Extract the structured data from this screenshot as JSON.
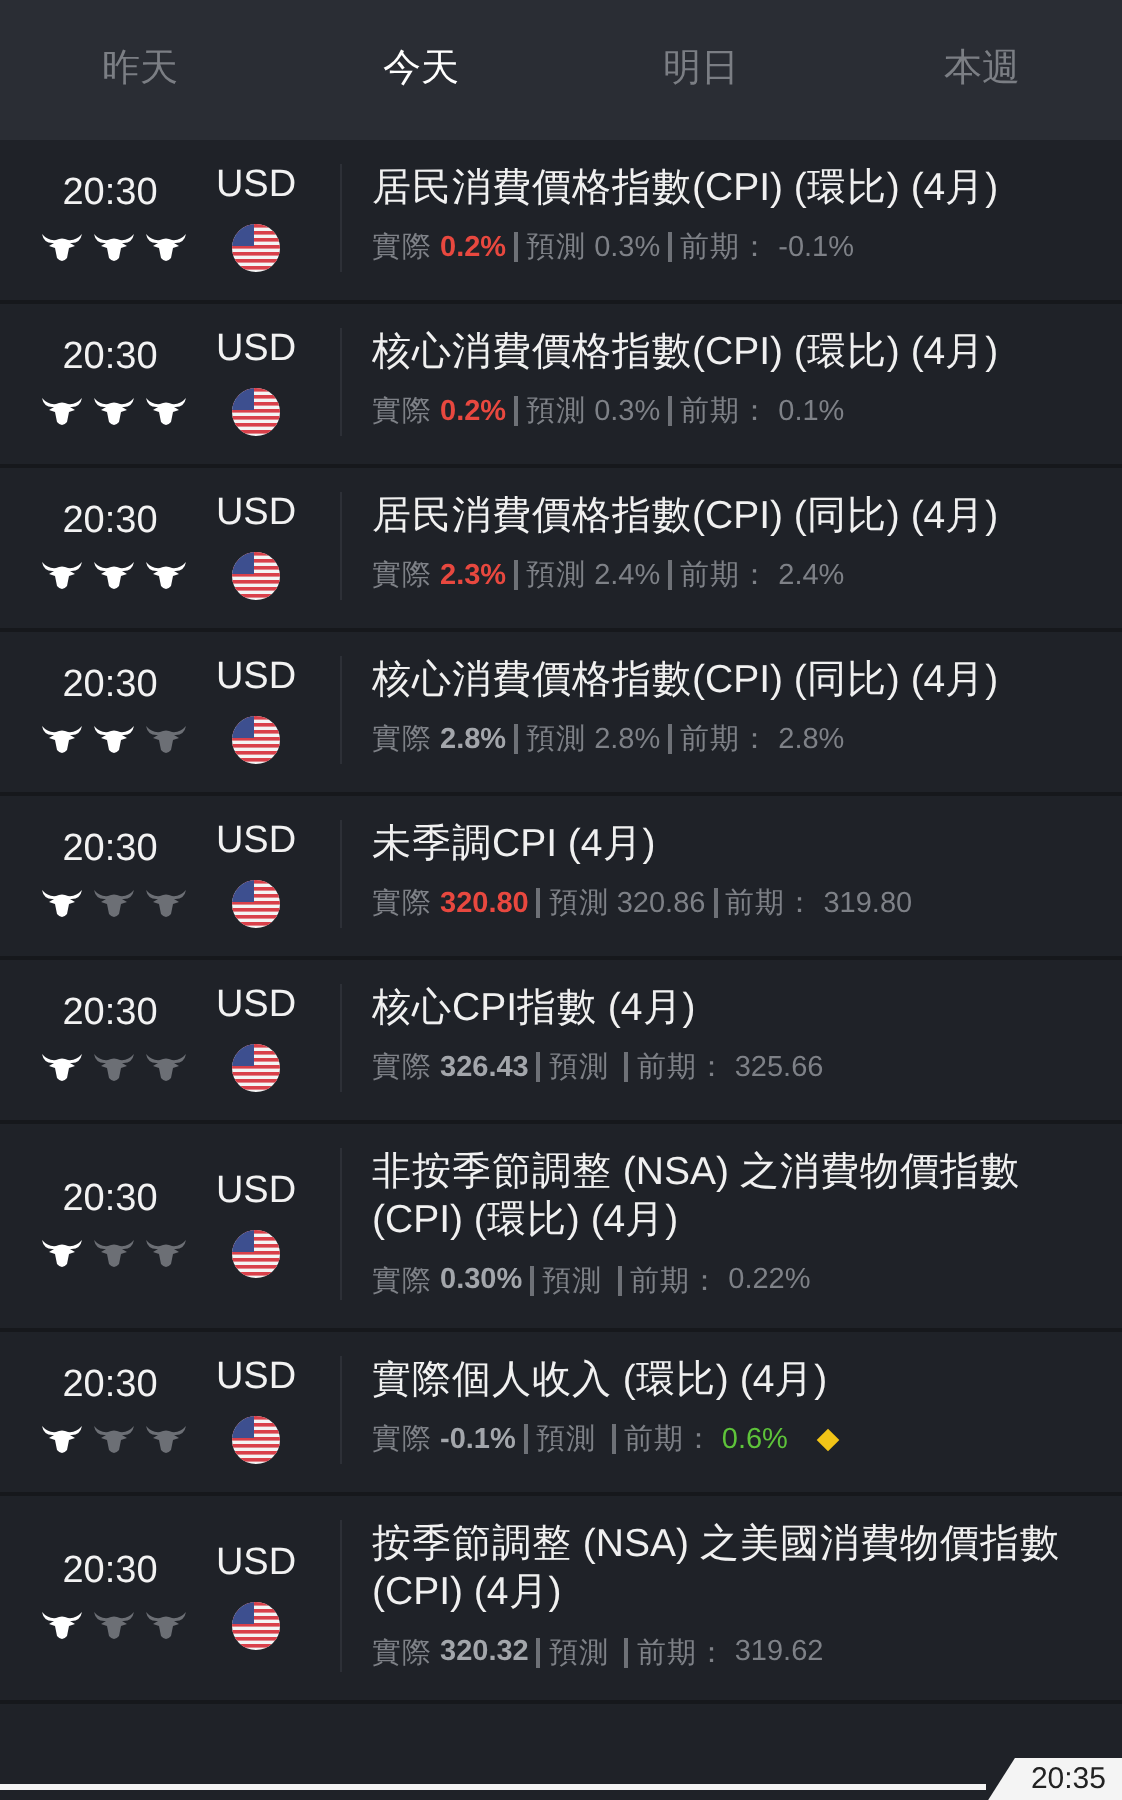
{
  "tabs": [
    {
      "label": "昨天",
      "selected": false
    },
    {
      "label": "今天",
      "selected": true
    },
    {
      "label": "明日",
      "selected": false
    },
    {
      "label": "本週",
      "selected": false
    }
  ],
  "events": [
    {
      "time": "20:30",
      "stars": 3,
      "currency": "USD",
      "title": "居民消費價格指數(CPI) (環比) (4月)",
      "actual_label": "實際",
      "actual": {
        "text": "0.2%",
        "color": "#e8483f"
      },
      "forecast_label": "預測",
      "forecast": "0.3%",
      "previous_label": "前期：",
      "previous": {
        "text": "-0.1%",
        "color": "#7e8187"
      },
      "revised": false
    },
    {
      "time": "20:30",
      "stars": 3,
      "currency": "USD",
      "title": "核心消費價格指數(CPI) (環比) (4月)",
      "actual_label": "實際",
      "actual": {
        "text": "0.2%",
        "color": "#e8483f"
      },
      "forecast_label": "預測",
      "forecast": "0.3%",
      "previous_label": "前期：",
      "previous": {
        "text": "0.1%",
        "color": "#7e8187"
      },
      "revised": false
    },
    {
      "time": "20:30",
      "stars": 3,
      "currency": "USD",
      "title": "居民消費價格指數(CPI) (同比) (4月)",
      "actual_label": "實際",
      "actual": {
        "text": "2.3%",
        "color": "#e8483f"
      },
      "forecast_label": "預測",
      "forecast": "2.4%",
      "previous_label": "前期：",
      "previous": {
        "text": "2.4%",
        "color": "#7e8187"
      },
      "revised": false
    },
    {
      "time": "20:30",
      "stars": 2,
      "currency": "USD",
      "title": "核心消費價格指數(CPI) (同比) (4月)",
      "actual_label": "實際",
      "actual": {
        "text": "2.8%",
        "color": "#a3a6ab"
      },
      "forecast_label": "預測",
      "forecast": "2.8%",
      "previous_label": "前期：",
      "previous": {
        "text": "2.8%",
        "color": "#7e8187"
      },
      "revised": false
    },
    {
      "time": "20:30",
      "stars": 1,
      "currency": "USD",
      "title": "未季調CPI (4月)",
      "actual_label": "實際",
      "actual": {
        "text": "320.80",
        "color": "#e8483f"
      },
      "forecast_label": "預測",
      "forecast": "320.86",
      "previous_label": "前期：",
      "previous": {
        "text": "319.80",
        "color": "#7e8187"
      },
      "revised": false
    },
    {
      "time": "20:30",
      "stars": 1,
      "currency": "USD",
      "title": "核心CPI指數 (4月)",
      "actual_label": "實際",
      "actual": {
        "text": "326.43",
        "color": "#a3a6ab"
      },
      "forecast_label": "預測",
      "previous_label": "前期：",
      "previous": {
        "text": "325.66",
        "color": "#7e8187"
      },
      "revised": false
    },
    {
      "time": "20:30",
      "stars": 1,
      "currency": "USD",
      "title": "非按季節調整 (NSA) 之消費物價指數 (CPI) (環比) (4月)",
      "actual_label": "實際",
      "actual": {
        "text": "0.30%",
        "color": "#a3a6ab"
      },
      "forecast_label": "預測",
      "previous_label": "前期：",
      "previous": {
        "text": "0.22%",
        "color": "#7e8187"
      },
      "revised": false
    },
    {
      "time": "20:30",
      "stars": 1,
      "currency": "USD",
      "title": "實際個人收入 (環比) (4月)",
      "actual_label": "實際",
      "actual": {
        "text": "-0.1%",
        "color": "#a3a6ab"
      },
      "forecast_label": "預測",
      "previous_label": "前期：",
      "previous": {
        "text": "0.6%",
        "color": "#5ec43a"
      },
      "revised": true
    },
    {
      "time": "20:30",
      "stars": 1,
      "currency": "USD",
      "title": "按季節調整 (NSA) 之美國消費物價指數 (CPI) (4月)",
      "actual_label": "實際",
      "actual": {
        "text": "320.32",
        "color": "#a3a6ab"
      },
      "forecast_label": "預測",
      "previous_label": "前期：",
      "previous": {
        "text": "319.62",
        "color": "#7e8187"
      },
      "revised": false
    }
  ],
  "current_time": "20:35"
}
